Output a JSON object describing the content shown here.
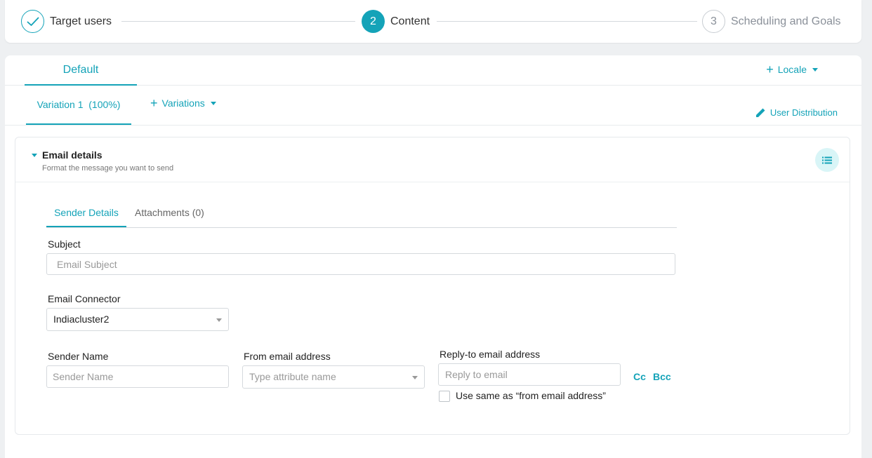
{
  "stepper": {
    "steps": [
      {
        "label": "Target users",
        "state": "done",
        "symbol": "check-icon"
      },
      {
        "label": "Content",
        "state": "active",
        "number": "2"
      },
      {
        "label": "Scheduling and Goals",
        "state": "pending",
        "number": "3"
      }
    ]
  },
  "locale_tabs": {
    "active_label": "Default",
    "locale_button": "Locale"
  },
  "variation_tabs": {
    "active_label": "Variation 1  (100%)",
    "variations_button": "Variations",
    "user_distribution": "User Distribution"
  },
  "email_details": {
    "title": "Email details",
    "subtitle": "Format the message you want to send",
    "tabs": [
      "Sender Details",
      "Attachments (0)"
    ],
    "subject": {
      "label": "Subject",
      "placeholder": "Email Subject"
    },
    "connector": {
      "label": "Email Connector",
      "value": "Indiacluster2"
    },
    "sender_name": {
      "label": "Sender Name",
      "placeholder": "Sender Name"
    },
    "from_email": {
      "label": "From email address",
      "placeholder": "Type attribute name"
    },
    "reply_to": {
      "label": "Reply-to email address",
      "placeholder": "Reply to email"
    },
    "cc_label": "Cc",
    "bcc_label": "Bcc",
    "same_as_from": "Use same as “from email address”"
  },
  "colors": {
    "accent": "#14a3b8",
    "accent_light": "#d9f5f7"
  }
}
